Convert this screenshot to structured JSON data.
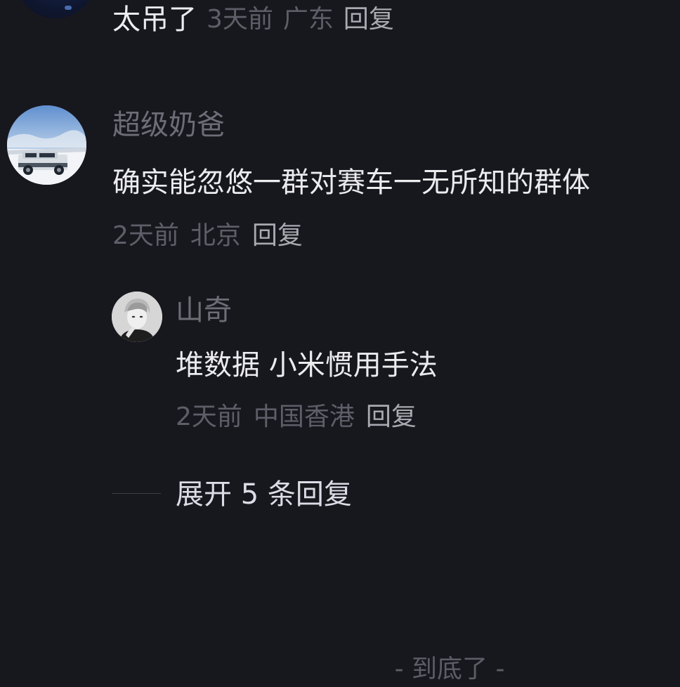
{
  "comments": [
    {
      "text": "太吊了",
      "time": "3天前",
      "location": "广东",
      "reply_label": "回复",
      "avatar_icon": "avatar-dark-night-icon"
    },
    {
      "username": "超级奶爸",
      "text": "确实能忽悠一群对赛车一无所知的群体",
      "time": "2天前",
      "location": "北京",
      "reply_label": "回复",
      "avatar_icon": "avatar-suv-snow-icon",
      "replies": [
        {
          "username": "山奇",
          "text": "堆数据 小米惯用手法",
          "time": "2天前",
          "location": "中国香港",
          "reply_label": "回复",
          "avatar_icon": "avatar-person-portrait-icon"
        }
      ],
      "expand_label": "展开 5 条回复"
    }
  ],
  "footer": {
    "end_label": "- 到底了 -"
  },
  "colors": {
    "background": "#17171e",
    "primary_text": "#ececef",
    "secondary_text": "#6d6d77",
    "meta_text": "#5e5e68",
    "reply_link": "#a9a9b1"
  }
}
